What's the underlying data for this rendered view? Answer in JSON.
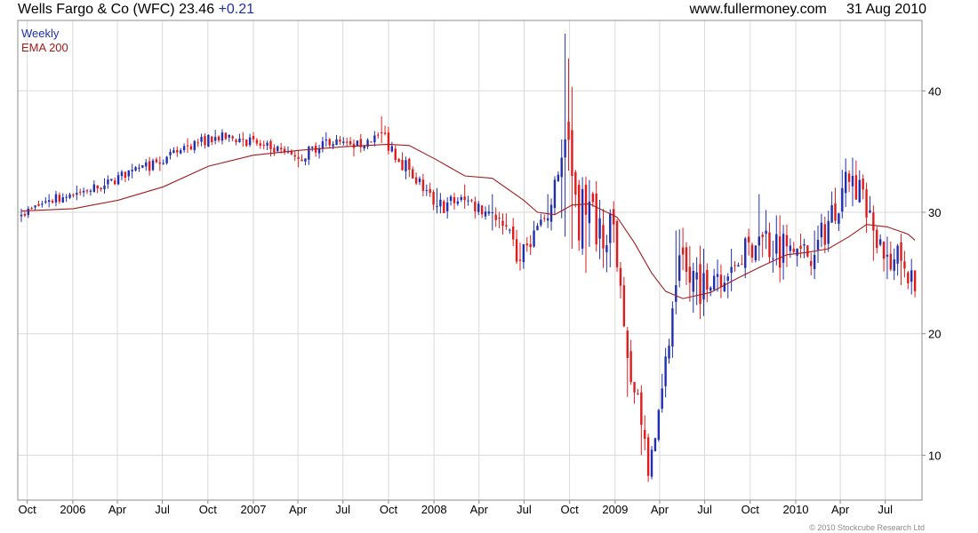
{
  "header": {
    "name": "Wells Fargo & Co (WFC)",
    "price": "23.46",
    "change": "+0.21",
    "site": "www.fullermoney.com",
    "date": "31 Aug 2010"
  },
  "legend": {
    "weekly": "Weekly",
    "ema": "EMA 200"
  },
  "footer": "© 2010 Stockcube Research Ltd",
  "colors": {
    "up": "#1f2fb0",
    "down": "#e11b1b",
    "ema": "#a31c1c",
    "grid": "#d9d9d9",
    "frame": "#8c8c8c"
  },
  "chart_data": {
    "type": "candlestick",
    "y_ticks": [
      10,
      20,
      30,
      40
    ],
    "ylim": [
      6.3,
      45.8
    ],
    "y_axis_side": "right",
    "x_tick_labels": [
      "Oct",
      "2006",
      "Apr",
      "Jul",
      "Oct",
      "2007",
      "Apr",
      "Jul",
      "Oct",
      "2008",
      "Apr",
      "Jul",
      "Oct",
      "2009",
      "Apr",
      "Jul",
      "Oct",
      "2010",
      "Apr",
      "Jul"
    ],
    "x_tick_dates": [
      "2005-10-01",
      "2006-01-01",
      "2006-04-01",
      "2006-07-01",
      "2006-10-01",
      "2007-01-01",
      "2007-04-01",
      "2007-07-01",
      "2007-10-01",
      "2008-01-01",
      "2008-04-01",
      "2008-07-01",
      "2008-10-01",
      "2009-01-01",
      "2009-04-01",
      "2009-07-01",
      "2009-10-01",
      "2010-01-01",
      "2010-04-01",
      "2010-07-01"
    ],
    "x_range": [
      "2005-09-19",
      "2010-09-06"
    ],
    "grid": true,
    "series": [
      {
        "name": "Weekly",
        "style": "candlestick",
        "dates": [
          "2005-09-19",
          "2005-11-14",
          "2006-01-09",
          "2006-03-06",
          "2006-05-01",
          "2006-06-26",
          "2006-08-21",
          "2006-10-16",
          "2006-12-11",
          "2007-02-05",
          "2007-04-02",
          "2007-05-28",
          "2007-07-23",
          "2007-09-17",
          "2007-11-12",
          "2008-01-07",
          "2008-03-03",
          "2008-04-28",
          "2008-06-23",
          "2008-07-21",
          "2008-08-18",
          "2008-09-15",
          "2008-09-22",
          "2008-10-06",
          "2008-11-03",
          "2008-12-29",
          "2009-01-26",
          "2009-02-23",
          "2009-03-09",
          "2009-04-06",
          "2009-05-04",
          "2009-06-29",
          "2009-08-24",
          "2009-10-19",
          "2009-12-14",
          "2010-02-08",
          "2010-04-05",
          "2010-04-26",
          "2010-06-07",
          "2010-07-05",
          "2010-08-02",
          "2010-08-30"
        ],
        "close": [
          29.8,
          31.0,
          31.6,
          32.2,
          33.5,
          34.0,
          35.5,
          36.2,
          36.0,
          35.2,
          34.4,
          36.0,
          35.3,
          36.5,
          33.5,
          30.5,
          31.0,
          30.0,
          26.0,
          28.5,
          29.5,
          34.5,
          36.0,
          33.0,
          29.8,
          29.0,
          18.0,
          12.5,
          8.3,
          15.5,
          24.0,
          25.0,
          25.5,
          28.0,
          27.2,
          26.5,
          32.0,
          33.0,
          28.5,
          26.5,
          26.0,
          23.5
        ],
        "high": [
          30.3,
          31.5,
          32.2,
          32.8,
          34.0,
          34.6,
          36.1,
          36.8,
          36.6,
          35.9,
          35.1,
          36.6,
          36.0,
          37.9,
          34.5,
          32.0,
          32.3,
          31.5,
          27.5,
          29.3,
          31.5,
          36.0,
          44.7,
          38.0,
          31.5,
          30.7,
          20.0,
          14.0,
          9.2,
          16.7,
          28.5,
          27.0,
          27.0,
          31.5,
          29.0,
          28.5,
          33.5,
          34.5,
          29.5,
          28.0,
          27.5,
          24.0
        ],
        "low": [
          29.2,
          30.4,
          31.0,
          31.6,
          32.8,
          33.4,
          34.9,
          35.6,
          35.4,
          34.6,
          33.7,
          35.4,
          34.6,
          35.7,
          32.9,
          29.9,
          30.3,
          28.5,
          25.2,
          27.8,
          28.7,
          29.5,
          28.0,
          27.0,
          25.0,
          27.5,
          14.8,
          10.0,
          7.8,
          13.5,
          21.6,
          22.5,
          23.5,
          26.0,
          25.5,
          24.5,
          29.5,
          30.5,
          26.0,
          24.5,
          24.0,
          23.0
        ]
      },
      {
        "name": "EMA 200",
        "style": "line",
        "dates": [
          "2005-09-19",
          "2006-01-02",
          "2006-04-03",
          "2006-07-03",
          "2006-10-02",
          "2007-01-01",
          "2007-04-02",
          "2007-07-02",
          "2007-10-01",
          "2007-11-12",
          "2008-01-07",
          "2008-03-03",
          "2008-04-28",
          "2008-06-30",
          "2008-07-28",
          "2008-09-01",
          "2008-10-06",
          "2008-11-10",
          "2009-01-05",
          "2009-02-09",
          "2009-03-16",
          "2009-04-13",
          "2009-05-18",
          "2009-07-13",
          "2009-09-07",
          "2009-10-26",
          "2009-12-14",
          "2010-01-25",
          "2010-03-08",
          "2010-04-19",
          "2010-05-24",
          "2010-07-05",
          "2010-08-16",
          "2010-08-30"
        ],
        "values": [
          30.1,
          30.3,
          31.0,
          32.1,
          33.8,
          34.7,
          35.1,
          35.4,
          35.6,
          35.5,
          34.3,
          33.0,
          32.8,
          31.0,
          30.0,
          29.8,
          30.6,
          30.7,
          29.6,
          27.5,
          25.0,
          23.5,
          22.9,
          23.4,
          24.6,
          25.6,
          26.5,
          26.7,
          27.0,
          28.0,
          29.0,
          28.8,
          28.2,
          27.7
        ]
      }
    ]
  }
}
